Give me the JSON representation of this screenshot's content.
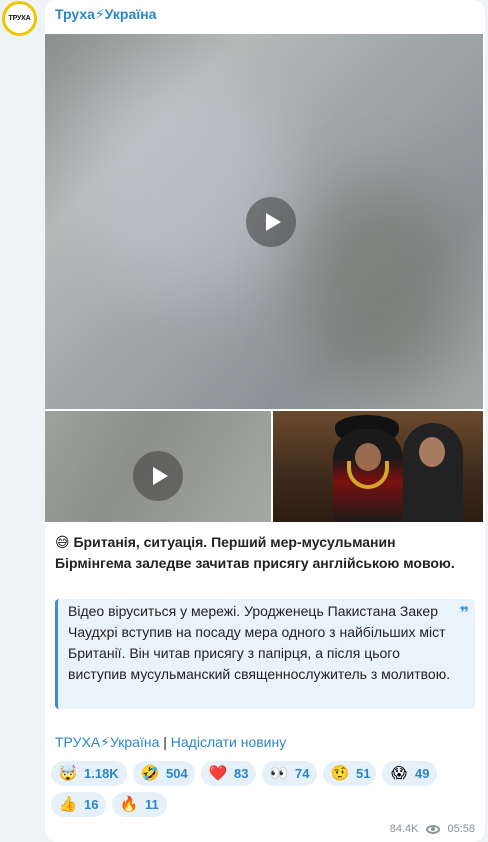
{
  "channel": {
    "avatar_text": "ТРУХА",
    "name": "Труха⚡Україна"
  },
  "post": {
    "headline": "😅 Британія, ситуація. Перший мер-мусульманин Бірмінгема заледве зачитав присягу англійською мовою.",
    "quote": "Відео віруситься у мережі. Уродженець Пакистана Закер Чаудхрі вступив на посаду мера одного з найбільших міст Британії. Він читав присягу з папірця, а після цього виступив мусульманский священнослужитель з молитвою.",
    "quote_mark": "❞"
  },
  "links": {
    "channel_link": "ТРУХА⚡Україна",
    "separator": " | ",
    "submit_link": "Надіслати новину"
  },
  "reactions": [
    {
      "emoji": "🤯",
      "count": "1.18K"
    },
    {
      "emoji": "🤣",
      "count": "504"
    },
    {
      "emoji": "❤️",
      "count": "83"
    },
    {
      "emoji": "👀",
      "count": "74"
    },
    {
      "emoji": "🤨",
      "count": "51"
    },
    {
      "emoji": "😱",
      "count": "49"
    },
    {
      "emoji": "👍",
      "count": "16"
    },
    {
      "emoji": "🔥",
      "count": "11"
    }
  ],
  "footer": {
    "views": "84.4K",
    "time": "05:58"
  }
}
